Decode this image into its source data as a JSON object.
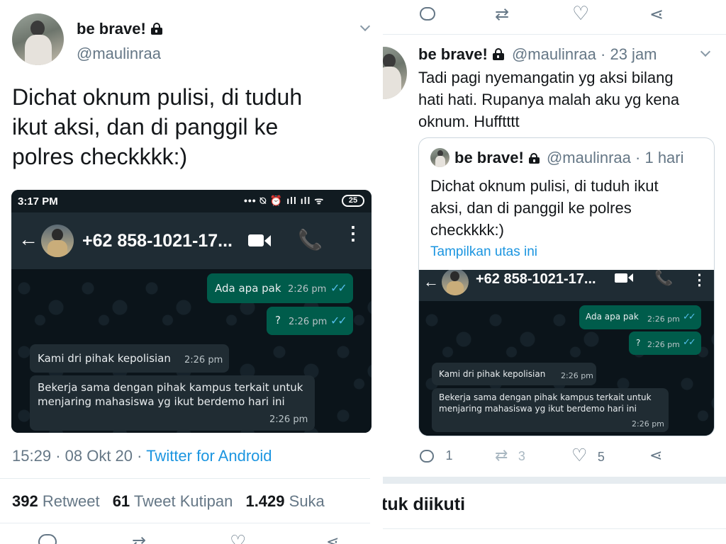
{
  "left": {
    "author": {
      "name": "be brave!",
      "handle": "@maulinraa"
    },
    "tweet_text": [
      "Dichat oknum pulisi, di tuduh",
      "ikut aksi, dan di panggil ke",
      "polres checkkkk:)"
    ],
    "timestamp": {
      "time": "15:29",
      "date": "08 Okt 20",
      "separator": "·",
      "source": "Twitter for Android"
    },
    "stats": {
      "retweets": {
        "count": "392",
        "label": "Retweet"
      },
      "quotes": {
        "count": "61",
        "label": "Tweet Kutipan"
      },
      "likes": {
        "count": "1.429",
        "label": "Suka"
      }
    }
  },
  "whatsapp": {
    "status_time": "3:17 PM",
    "battery": "25",
    "contact": "+62 858-1021-17...",
    "messages": [
      {
        "dir": "out",
        "text": "Ada apa pak",
        "time": "2:26 pm"
      },
      {
        "dir": "out",
        "text": "?",
        "time": "2:26 pm"
      },
      {
        "dir": "in",
        "text": "Kami dri pihak kepolisian",
        "time": "2:26 pm"
      },
      {
        "dir": "in",
        "text_line1": "Bekerja sama dengan pihak kampus terkait untuk",
        "text_line2": "menjaring mahasiswa yg ikut berdemo hari ini",
        "time": "2:26 pm"
      }
    ]
  },
  "right": {
    "reply": {
      "name": "be brave!",
      "handle": "@maulinraa",
      "age": "23 jam",
      "dot": "·",
      "text": [
        "Tadi pagi nyemangatin yg aksi bilang",
        "hati hati. Rupanya malah aku yg kena",
        "oknum. Hufftttt"
      ]
    },
    "quoted": {
      "name": "be brave!",
      "handle": "@maulinraa",
      "age": "1 hari",
      "dot": "·",
      "text": [
        "Dichat oknum pulisi, di tuduh ikut",
        "aksi, dan di panggil ke polres",
        "checkkkk:)"
      ],
      "thread_link": "Tampilkan utas ini"
    },
    "actions": {
      "replies": "1",
      "retweets": "3",
      "likes": "5"
    },
    "section_title": "tuk diikuti"
  },
  "colors": {
    "link": "#1b95e0",
    "muted": "#657786",
    "text": "#14171a",
    "wa_out": "#005c4b",
    "wa_in": "#202c33",
    "ticks": "#53bdeb"
  }
}
